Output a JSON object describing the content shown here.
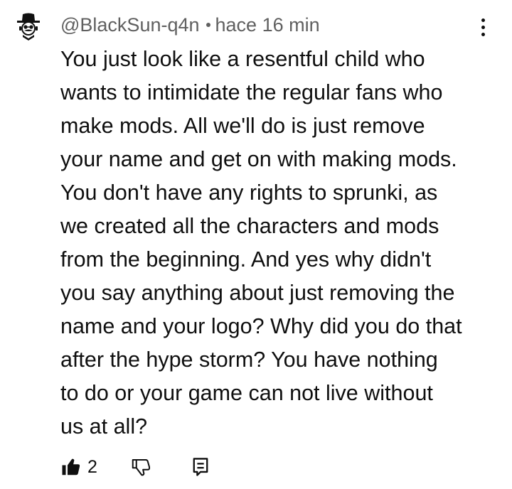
{
  "comment": {
    "author": "@BlackSun-q4n",
    "timestamp": "hace 16 min",
    "avatar_icon": "detective-face-icon",
    "lines": [
      "You just look like a resentful child who",
      "wants to intimidate the regular fans who",
      "make mods. All we'll do is just remove",
      "your name and get on with making mods.",
      "You don't have any rights to sprunki, as",
      "we created all the characters and mods",
      "from the beginning. And yes why didn't",
      "you say anything about just removing the",
      "name and your logo? Why did you do that",
      "after the hype storm? You have nothing",
      "to do or your game can not live without",
      "us at all?"
    ],
    "like_count": "2",
    "menu_icon": "more-vertical-icon",
    "like_icon": "thumbs-up-filled-icon",
    "dislike_icon": "thumbs-down-icon",
    "reply_icon": "reply-comment-icon"
  }
}
